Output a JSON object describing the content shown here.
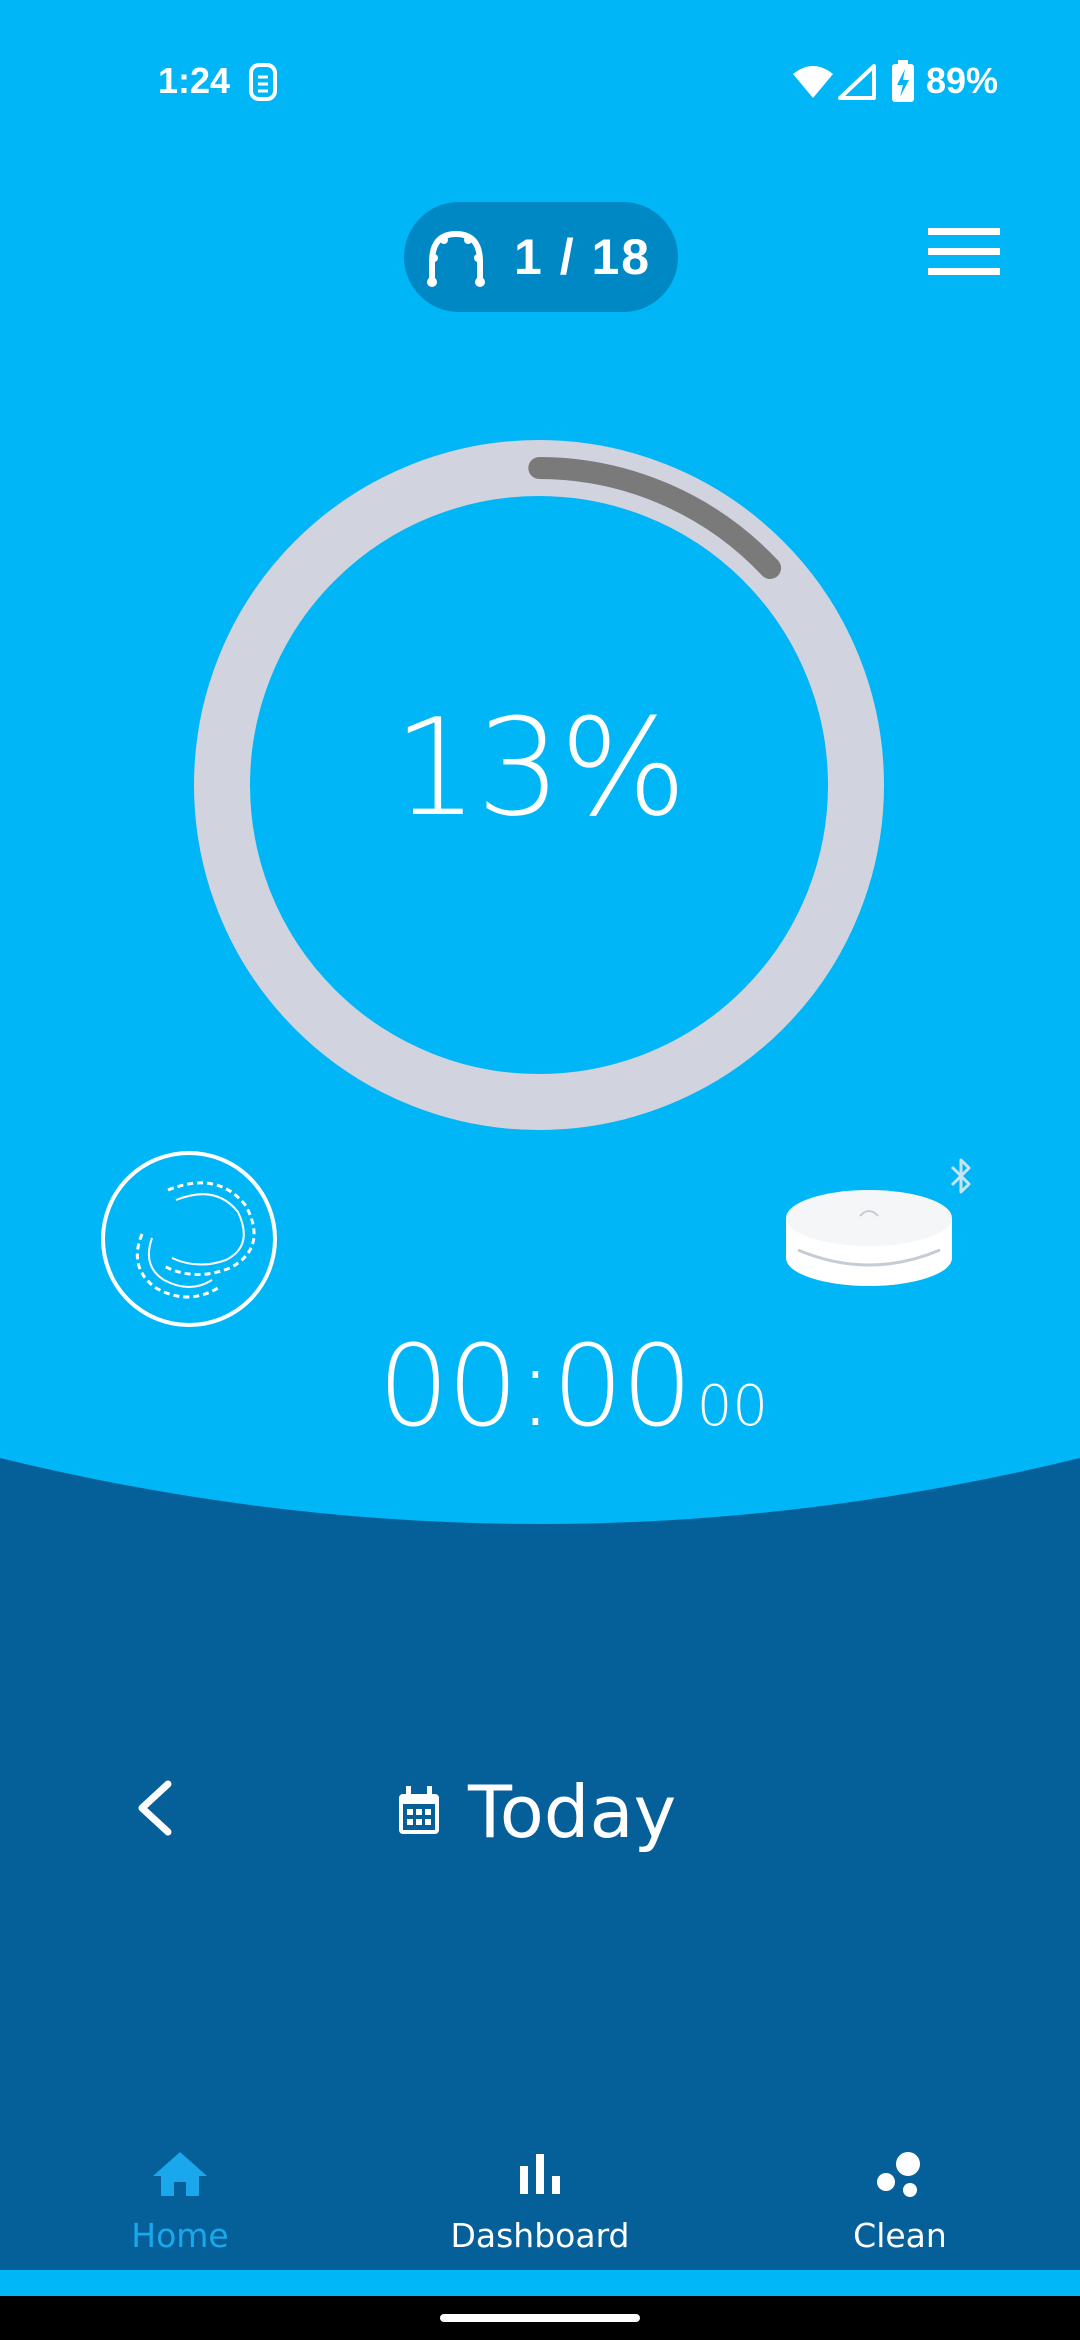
{
  "status_bar": {
    "time": "1:24",
    "battery": "89%"
  },
  "header": {
    "aligner_counter": "1 / 18"
  },
  "progress": {
    "percent_label": "13%",
    "value": 0.13
  },
  "timer": {
    "main": "00:00",
    "sub": "00"
  },
  "date_nav": {
    "label": "Today"
  },
  "bottom_nav": {
    "items": [
      {
        "label": "Home",
        "active": true
      },
      {
        "label": "Dashboard",
        "active": false
      },
      {
        "label": "Clean",
        "active": false
      }
    ]
  },
  "colors": {
    "primary_blue": "#00b6f6",
    "dark_blue": "#05609a",
    "pill_blue": "#0088c4",
    "ring_track": "#d1d3df",
    "ring_progress": "#7a7a7a",
    "active_nav": "#1aa7ec"
  },
  "icons": {
    "menu": "hamburger-menu-icon",
    "counter": "arch-aligner-icon",
    "aligner": "aligner-icon",
    "case": "aligner-case-icon",
    "bluetooth": "bluetooth-icon",
    "back": "chevron-left-icon",
    "calendar": "calendar-icon",
    "home": "home-icon",
    "dashboard": "bar-chart-icon",
    "clean": "bubbles-icon"
  }
}
